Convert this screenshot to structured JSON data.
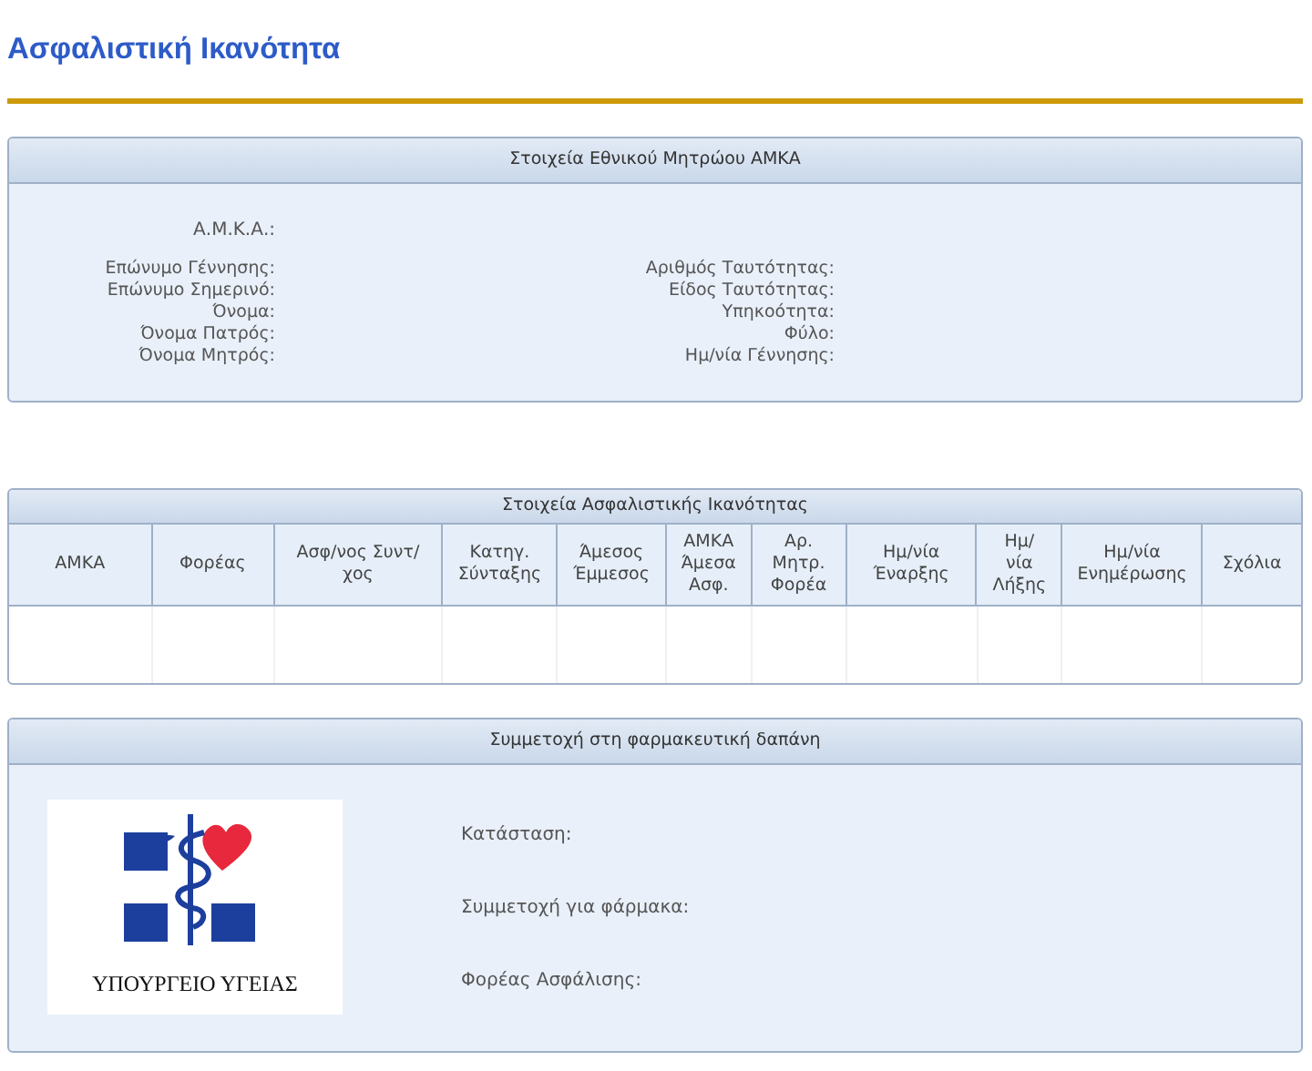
{
  "page_title": "Ασφαλιστική Ικανότητα",
  "registry_panel": {
    "title": "Στοιχεία Εθνικού Μητρώου ΑΜΚΑ",
    "amka_label": "Α.Μ.Κ.Α.:",
    "left_fields": [
      "Επώνυμο Γέννησης:",
      "Επώνυμο Σημερινό:",
      "Όνομα:",
      "Όνομα Πατρός:",
      "Όνομα Μητρός:"
    ],
    "right_fields": [
      "Αριθμός Ταυτότητας:",
      "Είδος Ταυτότητας:",
      "Υπηκοότητα:",
      "Φύλο:",
      "Ημ/νία Γέννησης:"
    ]
  },
  "insurance_table": {
    "title": "Στοιχεία Ασφαλιστικής Ικανότητας",
    "columns": [
      "ΑΜΚΑ",
      "Φορέας",
      "Ασφ/νος Συντ/ χος",
      "Κατηγ. Σύνταξης",
      "Άμεσος Έμμεσος",
      "ΑΜΚΑ Άμεσα Ασφ.",
      "Αρ. Μητρ. Φορέα",
      "Ημ/νία Έναρξης",
      "Ημ/ νία Λήξης",
      "Ημ/νία Ενημέρωσης",
      "Σχόλια"
    ]
  },
  "participation_panel": {
    "title": "Συμμετοχή στη φαρμακευτική δαπάνη",
    "logo_text": "ΥΠΟΥΡΓΕΙΟ ΥΓΕΙΑΣ",
    "fields": [
      "Κατάσταση:",
      "Συμμετοχή για φάρμακα:",
      "Φορέας Ασφάλισης:"
    ]
  }
}
